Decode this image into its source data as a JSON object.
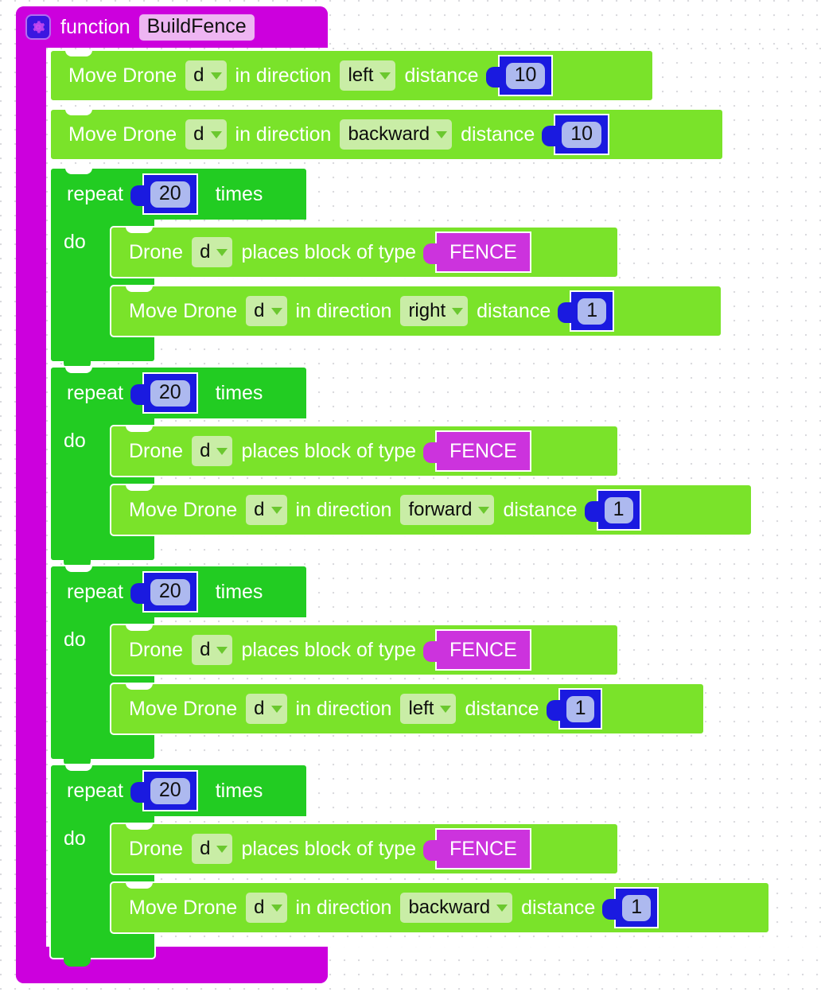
{
  "workspace": {
    "background_color": "#ffffff"
  },
  "function_block": {
    "gear_icon": "gear-icon",
    "keyword": "function",
    "name": "BuildFence",
    "color": "#cc00dd",
    "name_field_color": "#eeb5f2"
  },
  "labels": {
    "move_drone": "Move Drone",
    "in_direction": "in direction",
    "distance": "distance",
    "drone": "Drone",
    "places_block_of_type": "places block of type",
    "repeat": "repeat",
    "times": "times",
    "do": "do"
  },
  "colors": {
    "statement_block": "#7ae32a",
    "loop_block": "#22cc22",
    "number_block": "#1a1ae0",
    "number_field": "#adb9ef",
    "enum_block": "#cc33dd",
    "dropdown_field": "#c9eda6",
    "text": "#ffffff"
  },
  "statements": [
    {
      "id": "move-1",
      "type": "move-drone",
      "drone": "d",
      "direction": "left",
      "distance": "10"
    },
    {
      "id": "move-2",
      "type": "move-drone",
      "drone": "d",
      "direction": "backward",
      "distance": "10"
    }
  ],
  "loops": [
    {
      "id": "repeat-1",
      "count": "20",
      "body": [
        {
          "id": "place-1",
          "type": "place-block",
          "drone": "d",
          "block_type": "FENCE"
        },
        {
          "id": "move-3",
          "type": "move-drone",
          "drone": "d",
          "direction": "right",
          "distance": "1"
        }
      ]
    },
    {
      "id": "repeat-2",
      "count": "20",
      "body": [
        {
          "id": "place-2",
          "type": "place-block",
          "drone": "d",
          "block_type": "FENCE"
        },
        {
          "id": "move-4",
          "type": "move-drone",
          "drone": "d",
          "direction": "forward",
          "distance": "1"
        }
      ]
    },
    {
      "id": "repeat-3",
      "count": "20",
      "body": [
        {
          "id": "place-3",
          "type": "place-block",
          "drone": "d",
          "block_type": "FENCE"
        },
        {
          "id": "move-5",
          "type": "move-drone",
          "drone": "d",
          "direction": "left",
          "distance": "1"
        }
      ]
    },
    {
      "id": "repeat-4",
      "count": "20",
      "body": [
        {
          "id": "place-4",
          "type": "place-block",
          "drone": "d",
          "block_type": "FENCE"
        },
        {
          "id": "move-6",
          "type": "move-drone",
          "drone": "d",
          "direction": "backward",
          "distance": "1"
        }
      ]
    }
  ]
}
